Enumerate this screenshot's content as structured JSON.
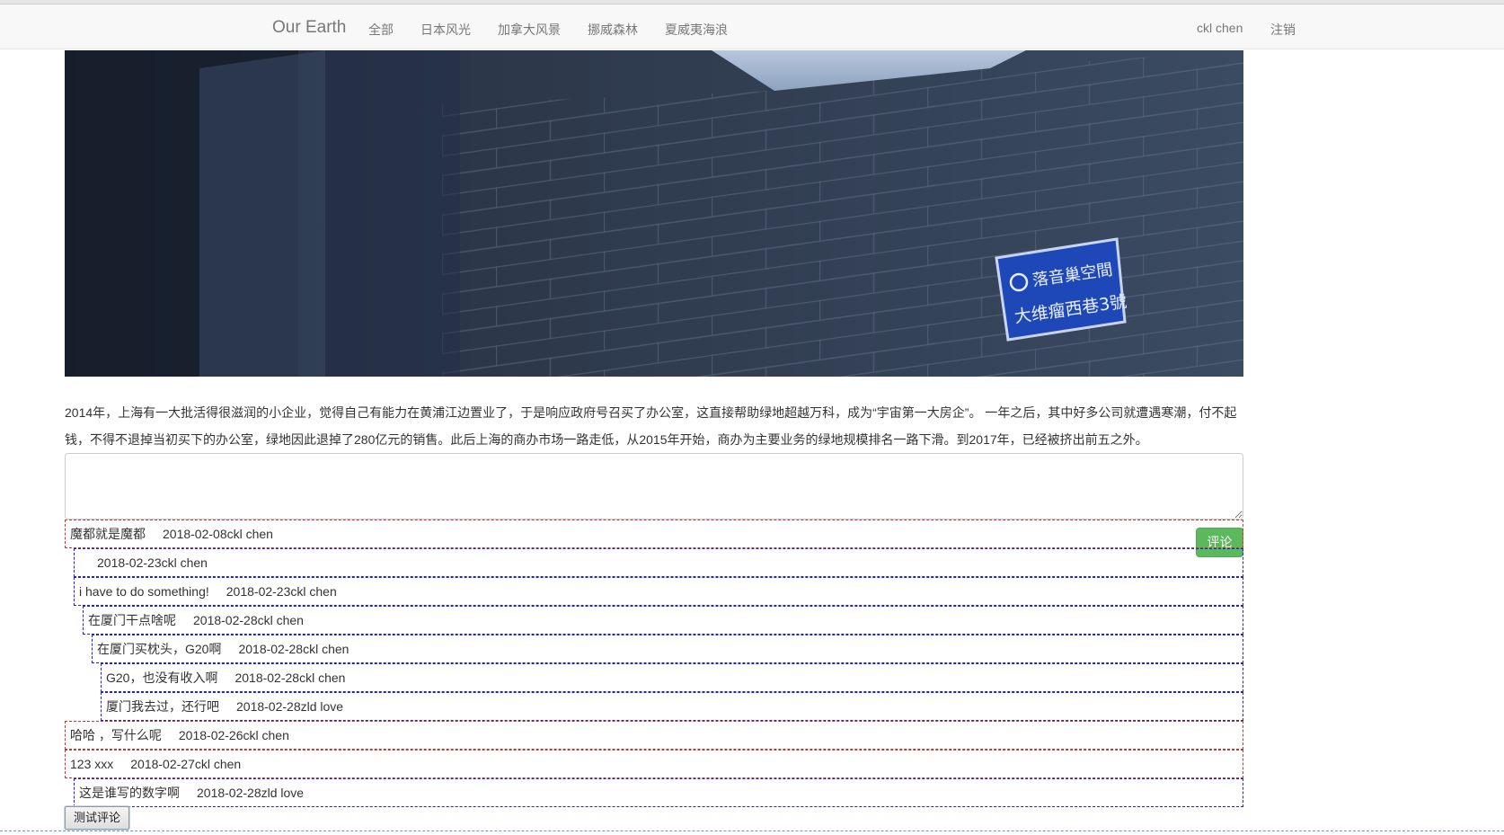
{
  "navbar": {
    "brand": "Our Earth",
    "items": [
      "全部",
      "日本风光",
      "加拿大风景",
      "挪威森林",
      "夏威夷海浪"
    ],
    "user": "ckl chen",
    "logout": "注销"
  },
  "hero": {
    "sign_line1": "落音巢空間",
    "sign_line2": "大维瘤西巷3號"
  },
  "article": {
    "text": "2014年，上海有一大批活得很滋润的小企业，觉得自己有能力在黄浦江边置业了，于是响应政府号召买了办公室，这直接帮助绿地超越万科，成为“宇宙第一大房企”。 一年之后，其中好多公司就遭遇寒潮，付不起钱，不得不退掉当初买下的办公室，绿地因此退掉了280亿元的销售。此后上海的商办市场一路走低，从2015年开始，商办为主要业务的绿地规模排名一路下滑。到2017年，已经被挤出前五之外。"
  },
  "comment_form": {
    "value": "",
    "submit_label": "评论"
  },
  "comments": [
    {
      "text": "魔都就是魔都",
      "meta": "2018-02-08ckl chen"
    },
    {
      "text": "",
      "meta": "2018-02-23ckl chen"
    },
    {
      "text": "i have to do something!",
      "meta": "2018-02-23ckl chen"
    },
    {
      "text": "在厦门干点啥呢",
      "meta": "2018-02-28ckl chen"
    },
    {
      "text": "在厦门买枕头，G20啊",
      "meta": "2018-02-28ckl chen"
    },
    {
      "text": "G20，也没有收入啊",
      "meta": "2018-02-28ckl chen"
    },
    {
      "text": "厦门我去过，还行吧",
      "meta": "2018-02-28zld love"
    },
    {
      "text": "哈哈 ，写什么呢",
      "meta": "2018-02-26ckl chen"
    },
    {
      "text": "123 xxx",
      "meta": "2018-02-27ckl chen"
    },
    {
      "text": "这是谁写的数字啊",
      "meta": "2018-02-28zld love"
    }
  ],
  "test_button": "测试评论",
  "colors": {
    "top_level_border": "#c0392b",
    "reply_border": "#1f1fe0",
    "submit_green": "#5cb85c"
  }
}
